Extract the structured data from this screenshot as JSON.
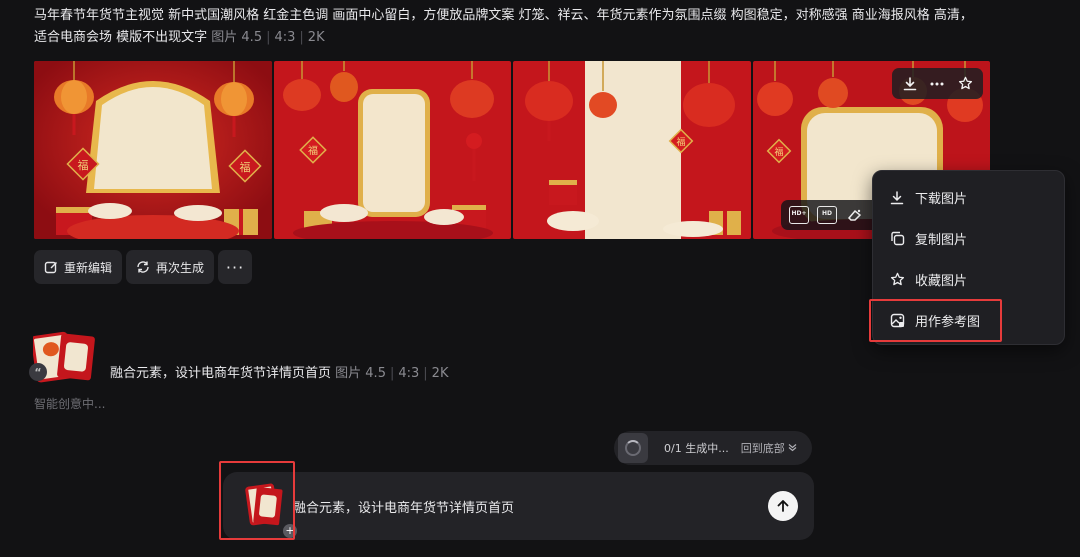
{
  "prompt1": {
    "text": "马年春节年货节主视觉 新中式国潮风格 红金主色调 画面中心留白，方便放品牌文案 灯笼、祥云、年货元素作为氛围点缀 构图稳定，对称感强 商业海报风格 高清，适合电商会场 模版不出现文字",
    "kind": "图片 4.5",
    "ratio": "4:3",
    "res": "2K"
  },
  "gallery": {
    "images": [
      "generated-image-1",
      "generated-image-2",
      "generated-image-3",
      "generated-image-4"
    ],
    "fu": "福"
  },
  "image_toolbar": {
    "icons": [
      "download-icon",
      "more-icon",
      "star-icon"
    ]
  },
  "thumb_tools": {
    "labels": [
      "HD+",
      "HD"
    ]
  },
  "actions": {
    "reedit": "重新编辑",
    "regenerate": "再次生成",
    "more": "···"
  },
  "context_menu": {
    "items": [
      {
        "label": "下载图片",
        "icon": "download-icon"
      },
      {
        "label": "复制图片",
        "icon": "copy-icon"
      },
      {
        "label": "收藏图片",
        "icon": "star-icon"
      },
      {
        "label": "用作参考图",
        "icon": "image-reference-icon"
      }
    ]
  },
  "prompt2": {
    "text": "融合元素，设计电商年货节详情页首页",
    "kind": "图片 4.5",
    "ratio": "4:3",
    "res": "2K",
    "quote": "“"
  },
  "thinking": "智能创意中...",
  "status": {
    "progress": "0/1",
    "label": "生成中...",
    "back": "回到底部"
  },
  "composer": {
    "text": "融合元素，设计电商年货节详情页首页",
    "plus": "+"
  },
  "colors": {
    "bg": "#121214",
    "red": "#c8181e",
    "gold": "#e0b04a",
    "highlight": "#e63b3b"
  }
}
